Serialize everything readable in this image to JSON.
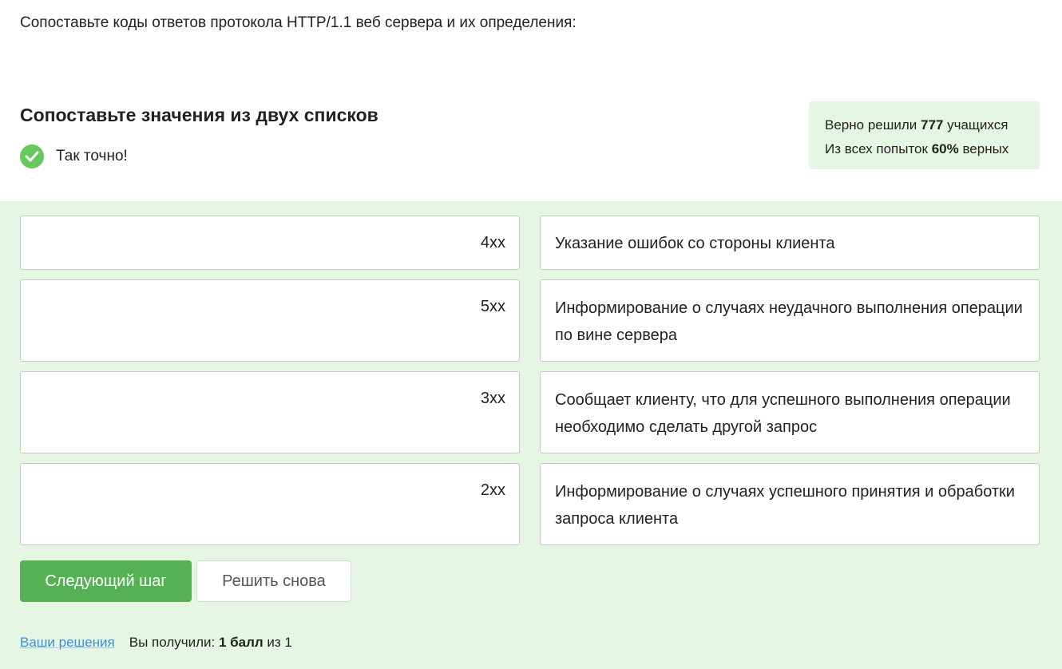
{
  "question": "Сопоставьте коды ответов протокола HTTP/1.1 веб сервера и их определения:",
  "task_title": "Сопоставьте значения из двух списков",
  "feedback": {
    "text": "Так точно!",
    "icon": "check-circle-icon",
    "color": "#66c95d"
  },
  "stats": {
    "solved_prefix": "Верно решили ",
    "solved_count": "777",
    "solved_suffix": " учащихся",
    "attempts_prefix": "Из всех попыток ",
    "attempts_percent": "60%",
    "attempts_suffix": " верных"
  },
  "pairs": [
    {
      "code": "4xx",
      "definition": "Указание ошибок со стороны клиента"
    },
    {
      "code": "5xx",
      "definition": "Информирование о случаях неудачного выполнения операции по вине сервера"
    },
    {
      "code": "3xx",
      "definition": "Сообщает клиенту, что для успешного выполнения операции необходимо сделать другой запрос"
    },
    {
      "code": "2xx",
      "definition": "Информирование о случаях успешного принятия и обработки запроса клиента"
    }
  ],
  "buttons": {
    "next": "Следующий шаг",
    "retry": "Решить снова"
  },
  "footer": {
    "solutions_link": "Ваши решения",
    "score_prefix": "Вы получили: ",
    "score_value": "1 балл",
    "score_suffix": " из 1"
  },
  "colors": {
    "accent_green": "#54b154",
    "panel_bg": "#e6f6e4",
    "link": "#3d8fd6"
  }
}
